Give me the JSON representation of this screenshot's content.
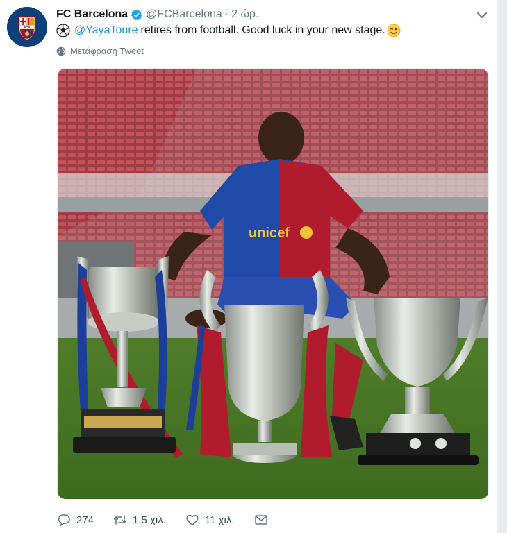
{
  "tweet": {
    "author_name": "FC Barcelona",
    "handle": "@FCBarcelona",
    "separator": "·",
    "time": "2 ώρ.",
    "mention": "@YayaToure",
    "text": "retires from football. Good luck in your new stage.",
    "translate_label": "Μετάφραση Tweet"
  },
  "photo": {
    "shirt_sponsor": "unicef"
  },
  "actions": {
    "replies": "274",
    "retweets": "1,5 χιλ.",
    "likes": "11 χιλ."
  },
  "icons": [
    "club-crest-icon",
    "verified-badge-icon",
    "chevron-down-icon",
    "soccer-ball-icon",
    "winking-face-icon",
    "globe-icon",
    "reply-icon",
    "retweet-icon",
    "like-icon",
    "message-icon"
  ],
  "colors": {
    "link": "#1b95e0",
    "muted": "#657786",
    "verified": "#1da1f2"
  }
}
